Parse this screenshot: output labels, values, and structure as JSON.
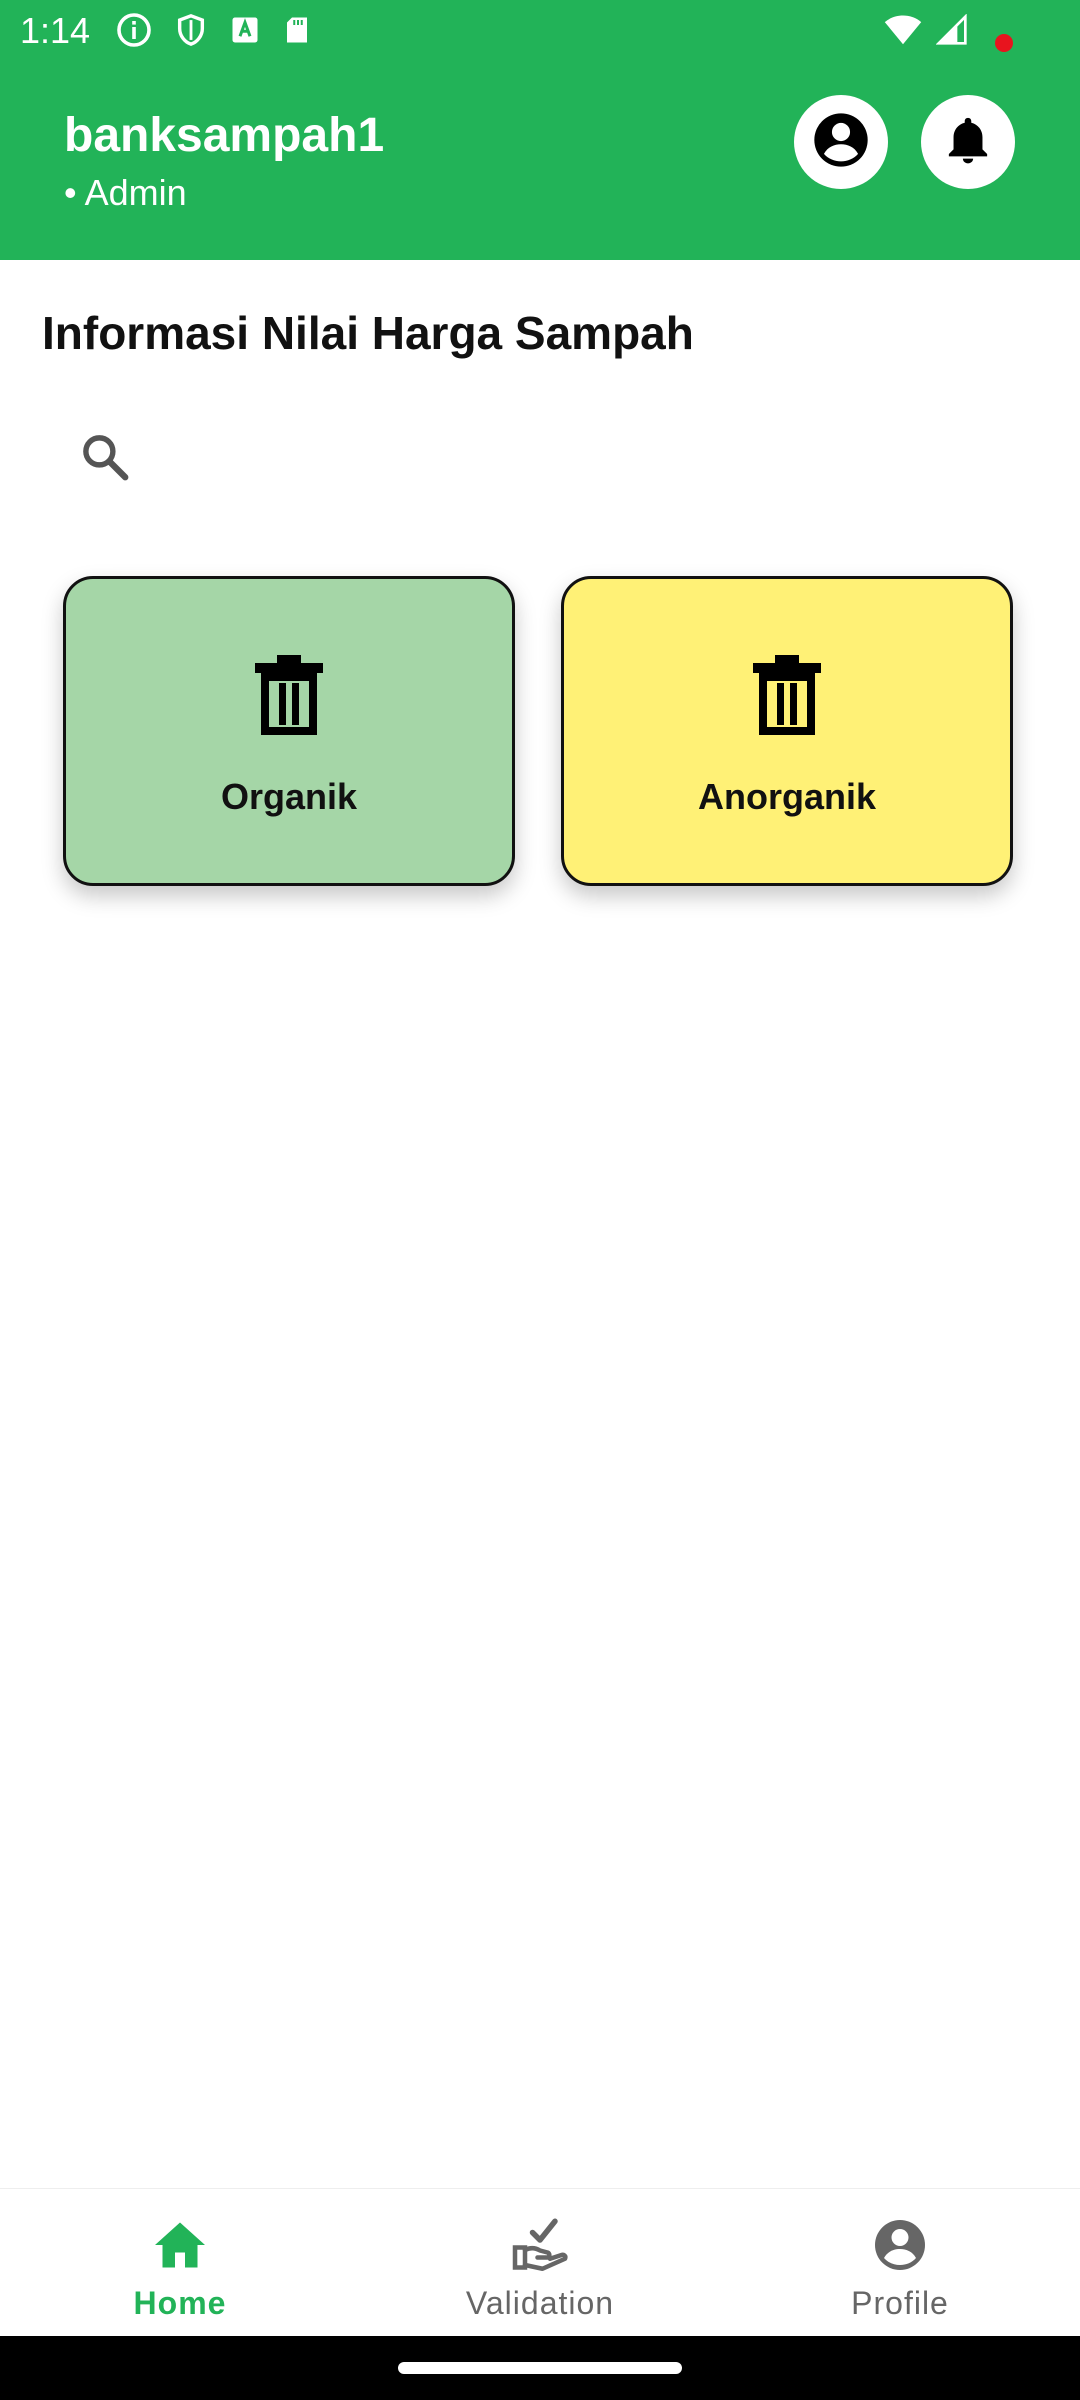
{
  "status_bar": {
    "time": "1:14",
    "left_icons": [
      "info-icon",
      "shield-icon",
      "a-text-icon",
      "sd-card-icon"
    ],
    "right_icons": [
      "wifi-icon",
      "signal-icon"
    ]
  },
  "header": {
    "user_name": "banksampah1",
    "user_role": "• Admin",
    "account_icon": "account-circle-icon",
    "notification_icon": "bell-icon",
    "notification_unread": true
  },
  "main": {
    "title": "Informasi Nilai Harga Sampah",
    "search": {
      "value": "",
      "placeholder": ""
    },
    "categories": [
      {
        "label": "Organik",
        "icon": "trash-icon",
        "color": "#a5d6a7"
      },
      {
        "label": "Anorganik",
        "icon": "trash-icon",
        "color": "#fff176"
      }
    ]
  },
  "bottom_nav": {
    "items": [
      {
        "label": "Home",
        "icon": "home-icon",
        "active": true
      },
      {
        "label": "Validation",
        "icon": "hand-check-icon",
        "active": false
      },
      {
        "label": "Profile",
        "icon": "profile-circle-icon",
        "active": false
      }
    ]
  },
  "colors": {
    "primary": "#22b358",
    "notification_dot": "#e8141e",
    "organik_card": "#a5d6a7",
    "anorganik_card": "#fff176"
  }
}
